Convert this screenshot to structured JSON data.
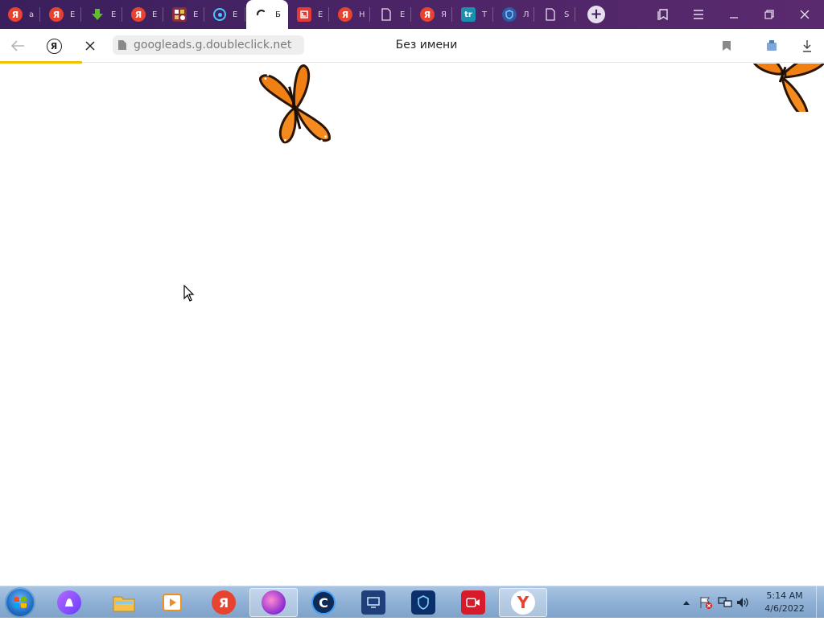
{
  "tabs": [
    {
      "icon": "yandex-icon",
      "title": "а"
    },
    {
      "icon": "yandex-icon",
      "title": "Е"
    },
    {
      "icon": "download-arrow-icon",
      "title": "Е"
    },
    {
      "icon": "yandex-icon",
      "title": "Е"
    },
    {
      "icon": "site-logo-icon",
      "title": "Е"
    },
    {
      "icon": "search-q-icon",
      "title": "Е"
    },
    {
      "icon": "loading-spinner-icon",
      "title": "Б",
      "active": true
    },
    {
      "icon": "red-square-icon",
      "title": "Е"
    },
    {
      "icon": "yandex-icon",
      "title": "Н"
    },
    {
      "icon": "document-icon",
      "title": "Е"
    },
    {
      "icon": "yandex-icon",
      "title": "Я"
    },
    {
      "icon": "tr-logo-icon",
      "title": "Т"
    },
    {
      "icon": "shield-icon",
      "title": "Л"
    },
    {
      "icon": "document-icon",
      "title": "S"
    }
  ],
  "address": {
    "url": "googleads.g.doubleclick.net",
    "page_title": "Без имени",
    "load_progress_percent": 10
  },
  "taskbar": {
    "apps": [
      {
        "icon": "alice-icon"
      },
      {
        "icon": "file-explorer-icon"
      },
      {
        "icon": "media-player-icon"
      },
      {
        "icon": "yandex-icon",
        "label": "Я"
      },
      {
        "icon": "browser-sphere-icon",
        "active": true
      },
      {
        "icon": "ccleaner-icon",
        "label": "C"
      },
      {
        "icon": "remote-desktop-icon"
      },
      {
        "icon": "vpn-shield-icon"
      },
      {
        "icon": "screen-recorder-icon"
      },
      {
        "icon": "yandex-browser-icon",
        "label": "Y",
        "active": true
      }
    ],
    "clock_time": "5:14 AM",
    "clock_date": "4/6/2022"
  },
  "colors": {
    "tab_strip": "#4a2466",
    "load_bar": "#f2c200",
    "taskbar": "#8fb1d6",
    "butterfly_orange": "#f07f14"
  }
}
